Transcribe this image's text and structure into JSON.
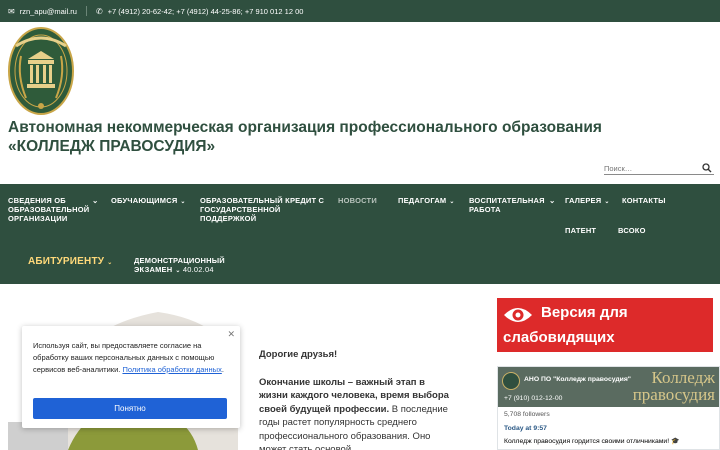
{
  "topbar": {
    "email": "rzn_apu@mail.ru",
    "phones": "+7 (4912) 20-62-42;  +7 (4912) 44-25-86;  +7 910 012 12 00"
  },
  "header": {
    "title": "Автономная некоммерческая организация профессионального образования «КОЛЛЕДЖ ПРАВОСУДИЯ»",
    "search_placeholder": "Поиск…"
  },
  "nav": {
    "items": [
      {
        "label": "Сведения об образовательной организации"
      },
      {
        "label": "Обучающимся"
      },
      {
        "label": "Образовательный кредит с государственной поддержкой"
      },
      {
        "label": "Новости"
      },
      {
        "label": "Педагогам"
      },
      {
        "label": "Воспитательная работа"
      },
      {
        "label": "Галерея"
      },
      {
        "label": "Контакты"
      },
      {
        "label": "Патент"
      },
      {
        "label": "Всоко"
      },
      {
        "label": "Абитуриенту"
      },
      {
        "label": "Демонстрационный экзамен",
        "sub": "40.02.04"
      }
    ]
  },
  "intro": {
    "greeting": "Дорогие друзья!",
    "lead": "Окончание школы – важный этап в жизни каждого человека, время выбора своей будущей профессии.",
    "text": " В последние годы растет популярность среднего профессионального образования. Оно может стать основой"
  },
  "cookie": {
    "text": "Используя сайт, вы предоставляете согласие на обработку ваших персональных данных с помощью сервисов веб-аналитики.",
    "link": "Политика обработки данных",
    "button": "Понятно"
  },
  "sidebar": {
    "vision_line1": "Версия для",
    "vision_line2": "слабовидящих",
    "vk": {
      "cover_title": "Колледж\nправосудия",
      "name": "АНО ПО \"Колледж правосудия\"",
      "phone": "+7 (910) 012-12-00",
      "followers": "5,708 followers",
      "time": "Today at 9:57",
      "post": "Колледж правосудия гордится своими отличниками! 🎓"
    }
  },
  "colors": {
    "brand_green": "#2f4f3f",
    "accent_red": "#dd2a2a",
    "link_blue": "#1f62d6",
    "nav_highlight": "#ffd97a"
  }
}
